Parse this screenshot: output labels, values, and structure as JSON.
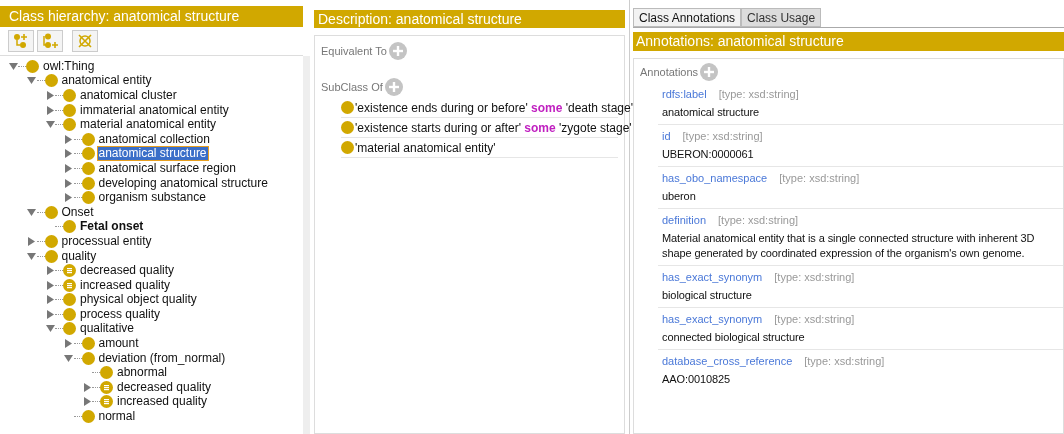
{
  "hierarchy": {
    "title": "Class hierarchy: anatomical structure",
    "tree": [
      {
        "label": "owl:Thing",
        "kind": "class",
        "selected": false,
        "expanded": true,
        "children": [
          {
            "label": "anatomical entity",
            "kind": "class",
            "selected": false,
            "expanded": true,
            "children": [
              {
                "label": "anatomical cluster",
                "kind": "class",
                "selected": false,
                "expanded": false
              },
              {
                "label": "immaterial anatomical entity",
                "kind": "class",
                "selected": false,
                "expanded": false
              },
              {
                "label": "material anatomical entity",
                "kind": "class",
                "selected": false,
                "expanded": true,
                "children": [
                  {
                    "label": "anatomical collection",
                    "kind": "class",
                    "selected": false,
                    "expanded": false
                  },
                  {
                    "label": "anatomical structure",
                    "kind": "class",
                    "selected": true,
                    "expanded": false
                  },
                  {
                    "label": "anatomical surface region",
                    "kind": "class",
                    "selected": false,
                    "expanded": false
                  },
                  {
                    "label": "developing anatomical structure",
                    "kind": "class",
                    "selected": false,
                    "expanded": false
                  },
                  {
                    "label": "organism substance",
                    "kind": "class",
                    "selected": false,
                    "expanded": false
                  }
                ]
              }
            ]
          },
          {
            "label": "Onset",
            "kind": "class",
            "selected": false,
            "expanded": true,
            "children": [
              {
                "label": "Fetal onset",
                "kind": "class",
                "selected": false,
                "bold": true
              }
            ]
          },
          {
            "label": "processual entity",
            "kind": "class",
            "selected": false,
            "expanded": false
          },
          {
            "label": "quality",
            "kind": "class",
            "selected": false,
            "expanded": true,
            "children": [
              {
                "label": "decreased quality",
                "kind": "defined",
                "selected": false,
                "expanded": false
              },
              {
                "label": "increased quality",
                "kind": "defined",
                "selected": false,
                "expanded": false
              },
              {
                "label": "physical object quality",
                "kind": "class",
                "selected": false,
                "expanded": false
              },
              {
                "label": "process quality",
                "kind": "class",
                "selected": false,
                "expanded": false
              },
              {
                "label": "qualitative",
                "kind": "class",
                "selected": false,
                "expanded": true,
                "children": [
                  {
                    "label": "amount",
                    "kind": "class",
                    "selected": false,
                    "expanded": false
                  },
                  {
                    "label": "deviation (from_normal)",
                    "kind": "class",
                    "selected": false,
                    "expanded": true,
                    "children": [
                      {
                        "label": "abnormal",
                        "kind": "class",
                        "selected": false
                      },
                      {
                        "label": "decreased quality",
                        "kind": "defined",
                        "selected": false,
                        "expanded": false
                      },
                      {
                        "label": "increased quality",
                        "kind": "defined",
                        "selected": false,
                        "expanded": false
                      }
                    ]
                  },
                  {
                    "label": "normal",
                    "kind": "class",
                    "selected": false
                  }
                ]
              }
            ]
          }
        ]
      }
    ]
  },
  "description": {
    "title": "Description: anatomical structure",
    "sections": [
      {
        "label": "Equivalent To"
      },
      {
        "label": "SubClass Of",
        "items": [
          {
            "parts": [
              {
                "kind": "entity",
                "text": "'existence ends during or before'"
              },
              {
                "kind": "keyword",
                "text": "some"
              },
              {
                "kind": "entity",
                "text": "'death stage'"
              }
            ]
          },
          {
            "parts": [
              {
                "kind": "entity",
                "text": "'existence starts during or after'"
              },
              {
                "kind": "keyword",
                "text": "some"
              },
              {
                "kind": "entity",
                "text": "'zygote stage'"
              }
            ]
          },
          {
            "parts": [
              {
                "kind": "entity",
                "text": "'material anatomical entity'"
              }
            ]
          }
        ]
      }
    ]
  },
  "annotations": {
    "tabs": [
      {
        "label": "Class Annotations",
        "selected": true
      },
      {
        "label": "Class Usage",
        "selected": false
      }
    ],
    "title": "Annotations: anatomical structure",
    "section_label": "Annotations",
    "items": [
      {
        "property": "rdfs:label",
        "type": "[type: xsd:string]",
        "value": "anatomical structure"
      },
      {
        "property": "id",
        "type": "[type: xsd:string]",
        "value": "UBERON:0000061"
      },
      {
        "property": "has_obo_namespace",
        "type": "[type: xsd:string]",
        "value": "uberon"
      },
      {
        "property": "definition",
        "type": "[type: xsd:string]",
        "value": "Material anatomical entity that is a single connected structure with inherent 3D shape generated by coordinated expression of the organism's own genome."
      },
      {
        "property": "has_exact_synonym",
        "type": "[type: xsd:string]",
        "value": "biological structure"
      },
      {
        "property": "has_exact_synonym",
        "type": "[type: xsd:string]",
        "value": "connected biological structure"
      },
      {
        "property": "database_cross_reference",
        "type": "[type: xsd:string]",
        "value": "AAO:0010825"
      }
    ]
  }
}
